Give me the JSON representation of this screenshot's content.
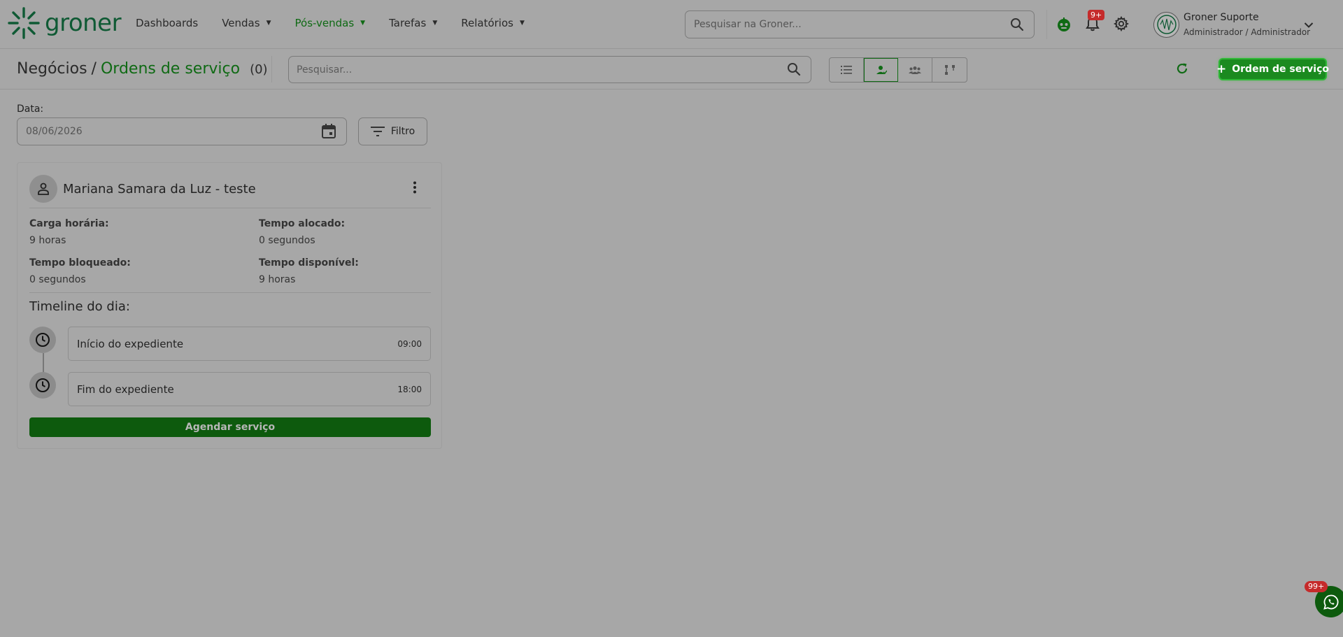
{
  "brand": {
    "name": "groner",
    "color": "#0f5a34"
  },
  "nav": {
    "items": [
      {
        "label": "Dashboards",
        "dropdown": false,
        "active": false
      },
      {
        "label": "Vendas",
        "dropdown": true,
        "active": false
      },
      {
        "label": "Pós-vendas",
        "dropdown": true,
        "active": true
      },
      {
        "label": "Tarefas",
        "dropdown": true,
        "active": false
      },
      {
        "label": "Relatórios",
        "dropdown": true,
        "active": false
      }
    ]
  },
  "top_search": {
    "placeholder": "Pesquisar na Groner..."
  },
  "notifications": {
    "badge": "9+"
  },
  "user": {
    "name": "Groner Suporte",
    "role": "Administrador / Administrador"
  },
  "page": {
    "breadcrumb_root": "Negócios",
    "breadcrumb_sep": "/",
    "breadcrumb_current": "Ordens de serviço",
    "count": "(0)",
    "search_placeholder": "Pesquisar...",
    "new_button": "Ordem de serviço",
    "view_modes": [
      "list-view-icon",
      "person-view-icon",
      "team-view-icon",
      "flow-view-icon"
    ],
    "active_view_index": 1
  },
  "filters": {
    "date_label": "Data:",
    "date_value": "08/06/2026",
    "filter_button": "Filtro"
  },
  "card": {
    "name": "Mariana Samara da Luz - teste",
    "stats": {
      "carga_label": "Carga horária:",
      "carga_value": "9 horas",
      "alocado_label": "Tempo alocado:",
      "alocado_value": "0 segundos",
      "bloqueado_label": "Tempo bloqueado:",
      "bloqueado_value": "0 segundos",
      "disponivel_label": "Tempo disponível:",
      "disponivel_value": "9 horas"
    },
    "timeline_title": "Timeline do dia:",
    "timeline": [
      {
        "label": "Início do expediente",
        "time": "09:00"
      },
      {
        "label": "Fim do expediente",
        "time": "18:00"
      }
    ],
    "schedule_button": "Agendar serviço"
  },
  "whatsapp": {
    "badge": "99+"
  },
  "colors": {
    "accent": "#0f6a14",
    "primary_button": "#1b8a1f",
    "badge": "#c52b2b",
    "background": "#a7a7a7"
  }
}
